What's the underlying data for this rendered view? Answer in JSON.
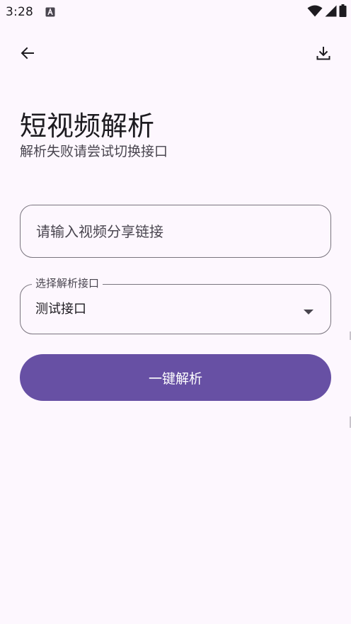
{
  "status_bar": {
    "time": "3:28",
    "app_icon": "a-letter-icon",
    "right_icons": [
      "wifi-icon",
      "cellular-signal-icon",
      "battery-icon"
    ]
  },
  "top_bar": {
    "back_icon": "arrow-back-icon",
    "download_icon": "download-icon"
  },
  "header": {
    "title": "短视频解析",
    "subtitle": "解析失败请尝试切换接口"
  },
  "link_input": {
    "placeholder": "请输入视频分享链接",
    "value": ""
  },
  "api_select": {
    "label": "选择解析接口",
    "selected": "测试接口",
    "icon": "dropdown-arrow-icon"
  },
  "parse_button": {
    "label": "一键解析"
  },
  "colors": {
    "background": "#FDF7FE",
    "primary": "#6750A4",
    "on_primary": "#FFFFFF",
    "outline": "#79747E",
    "text": "#1D1B20",
    "text_secondary": "#49454F"
  }
}
